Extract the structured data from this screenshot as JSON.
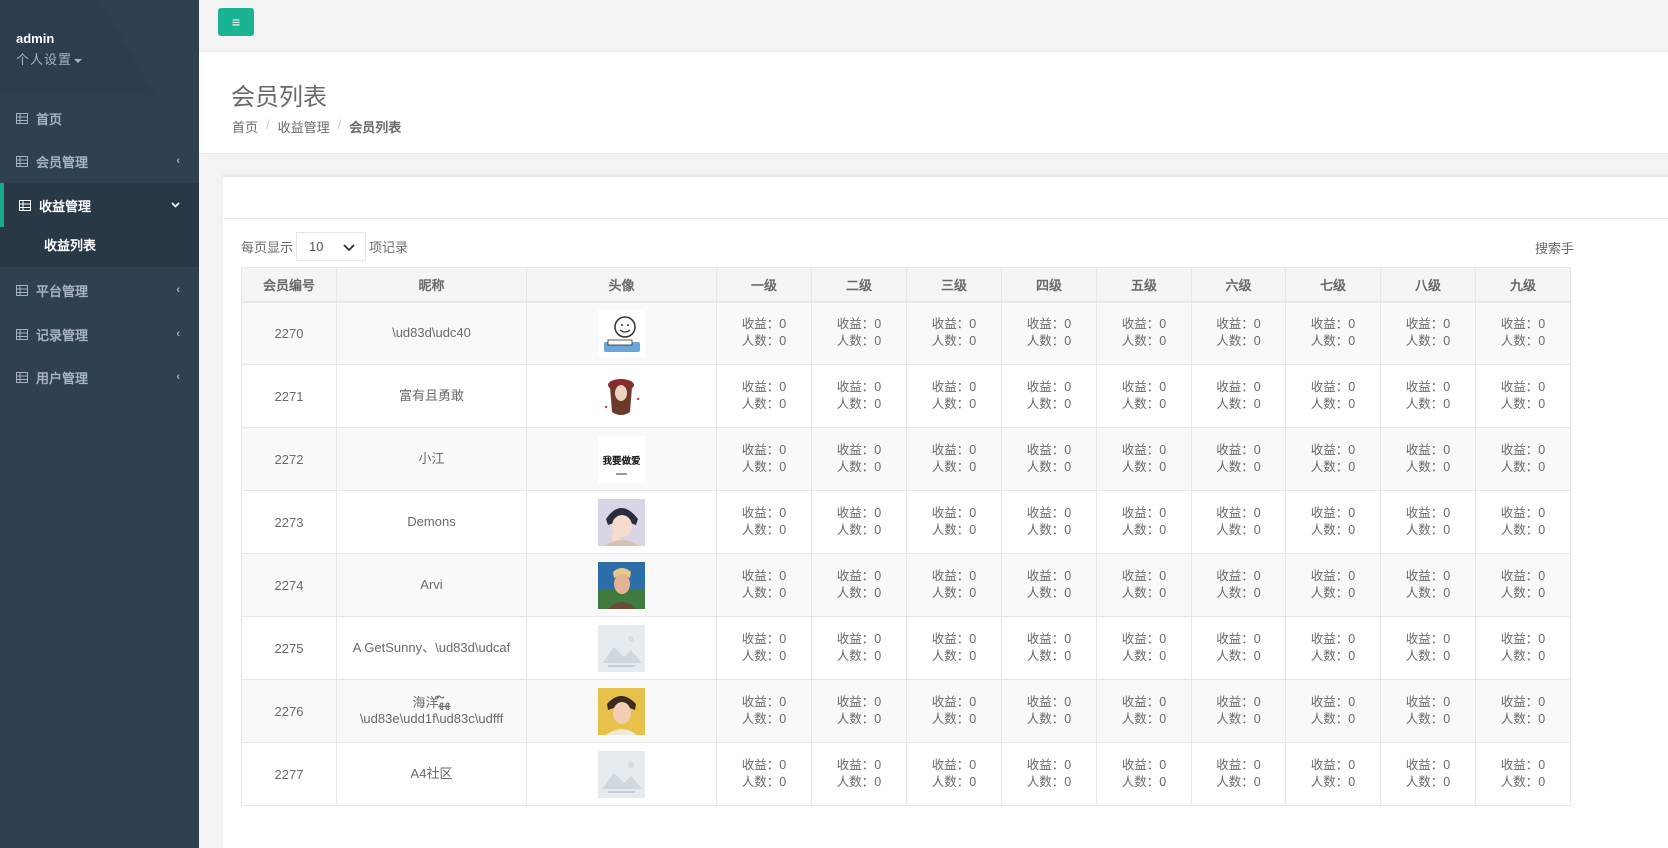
{
  "sidebar": {
    "user": "admin",
    "settings": "个人设置",
    "menu": [
      {
        "label": "首页"
      },
      {
        "label": "会员管理"
      },
      {
        "label": "收益管理"
      },
      {
        "label": "平台管理"
      },
      {
        "label": "记录管理"
      },
      {
        "label": "用户管理"
      }
    ],
    "submenu": {
      "label": "收益列表"
    }
  },
  "topbar": {
    "menu_button": "≡"
  },
  "heading": {
    "title": "会员列表",
    "breadcrumb": [
      "首页",
      "收益管理",
      "会员列表"
    ]
  },
  "table_controls": {
    "per_page_prefix": "每页显示",
    "per_page_value": "10",
    "per_page_suffix": "项记录",
    "search_label": "搜索手"
  },
  "table": {
    "headers": [
      "会员编号",
      "昵称",
      "头像",
      "一级",
      "二级",
      "三级",
      "四级",
      "五级",
      "六级",
      "七级",
      "八级",
      "九级"
    ],
    "earn_label": "收益：0",
    "count_label": "人数：0",
    "rows": [
      {
        "id": "2270",
        "nickname": "\\ud83d\\udc40",
        "avatar": "cartoon-reading"
      },
      {
        "id": "2271",
        "nickname": "富有且勇敢",
        "avatar": "girl-red-hat"
      },
      {
        "id": "2272",
        "nickname": "小江",
        "avatar": "text-avatar",
        "avatar_text": "我要做爱"
      },
      {
        "id": "2273",
        "nickname": "Demons",
        "avatar": "anime-boy"
      },
      {
        "id": "2274",
        "nickname": "Arvi",
        "avatar": "man-outdoor"
      },
      {
        "id": "2275",
        "nickname": "A GetSunny、\\ud83d\\udcaf",
        "avatar": "placeholder"
      },
      {
        "id": "2276",
        "nickname": "海洋ﻬ໌ﻬ\n\\ud83e\\udd1f\\ud83c\\udfff",
        "avatar": "young-man"
      },
      {
        "id": "2277",
        "nickname": "A4社区",
        "avatar": "placeholder"
      }
    ]
  },
  "colors": {
    "sidebar_bg": "#2f4050",
    "sidebar_active": "#293846",
    "accent": "#1ab394"
  }
}
